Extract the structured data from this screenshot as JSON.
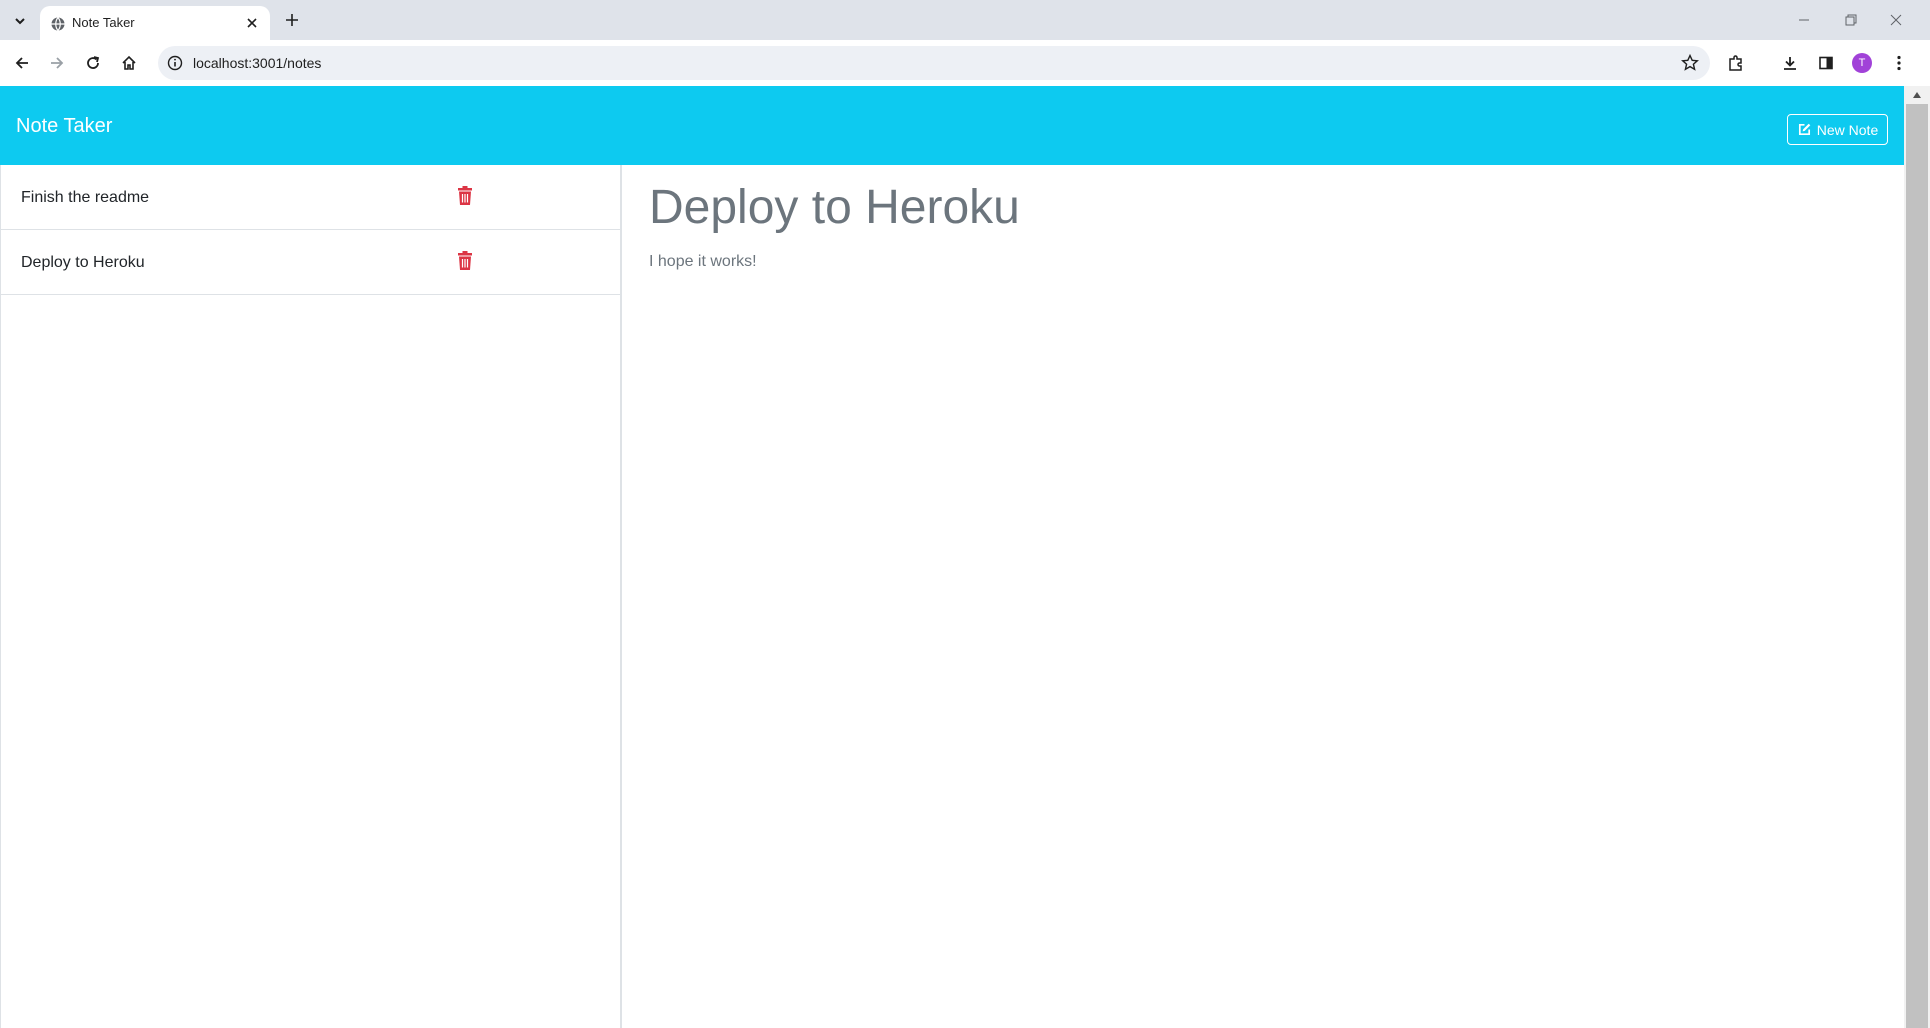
{
  "browser": {
    "tab_title": "Note Taker",
    "url": "localhost:3001/notes",
    "profile_initial": "T"
  },
  "app": {
    "brand": "Note Taker",
    "new_note_label": "New Note",
    "accent_color": "#0dcaf0",
    "delete_color": "#dc3545"
  },
  "notes": [
    {
      "title": "Finish the readme"
    },
    {
      "title": "Deploy to Heroku"
    }
  ],
  "active_note": {
    "title": "Deploy to Heroku",
    "text": "I hope it works!"
  }
}
